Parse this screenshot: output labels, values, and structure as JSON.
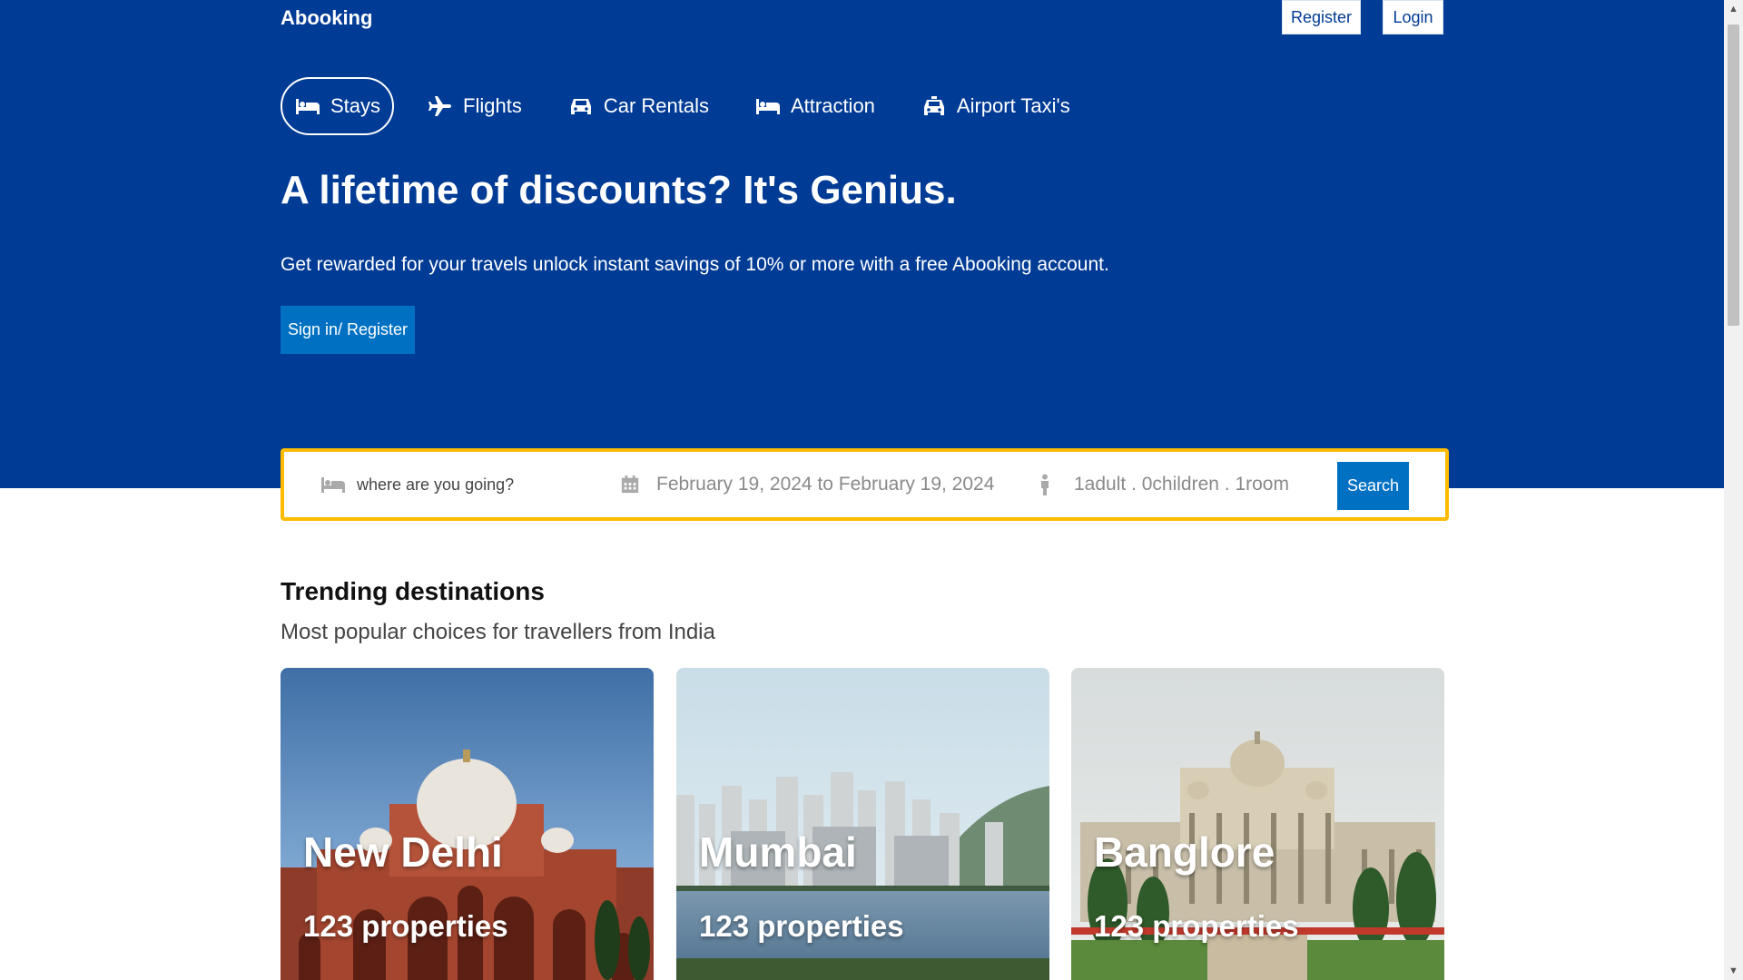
{
  "header": {
    "logo": "Abooking",
    "register_label": "Register",
    "login_label": "Login"
  },
  "nav": {
    "items": [
      {
        "label": "Stays",
        "icon": "bed-icon",
        "active": true
      },
      {
        "label": "Flights",
        "icon": "plane-icon",
        "active": false
      },
      {
        "label": "Car Rentals",
        "icon": "car-icon",
        "active": false
      },
      {
        "label": "Attraction",
        "icon": "bed-icon",
        "active": false
      },
      {
        "label": "Airport Taxi's",
        "icon": "taxi-icon",
        "active": false
      }
    ]
  },
  "hero": {
    "headline": "A lifetime of discounts? It's Genius.",
    "subline": "Get rewarded for your travels unlock instant savings of 10% or more with a free Abooking account.",
    "signin_label": "Sign in/ Register"
  },
  "search": {
    "where_placeholder": "where are you going?",
    "dates": "February 19, 2024 to February 19, 2024",
    "guests": "1adult . 0children . 1room",
    "button_label": "Search"
  },
  "trending": {
    "title": "Trending destinations",
    "subtitle": "Most popular choices for travellers from India",
    "cards": [
      {
        "city": "New Delhi",
        "properties": "123 properties"
      },
      {
        "city": "Mumbai",
        "properties": "123 properties"
      },
      {
        "city": "Banglore",
        "properties": "123 properties"
      }
    ]
  },
  "colors": {
    "brand": "#003b95",
    "accent": "#0071c2",
    "search_border": "#febb02"
  }
}
